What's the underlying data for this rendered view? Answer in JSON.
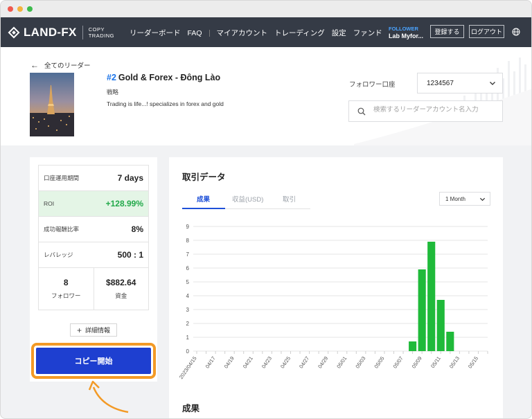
{
  "nav": {
    "logo_text": "LAND-FX",
    "logo_sub_line1": "COPY",
    "logo_sub_line2": "TRADING",
    "links": [
      "リーダーボード",
      "FAQ",
      "マイアカウント",
      "トレーディング",
      "設定",
      "ファンド"
    ],
    "follower_label": "FOLLOWER",
    "follower_name": "Lab Myfor...",
    "register_label": "登録する",
    "logout_label": "ログアウト"
  },
  "header": {
    "back_label": "全てのリーダー",
    "rank": "#2",
    "leader_name": "Gold & Forex - Đông Lào",
    "strategy_label": "戦略",
    "strategy_text": "Trading is life...! specializes in forex and gold",
    "follower_account_label": "フォロワー口座",
    "follower_account_value": "1234567",
    "search_placeholder": "検索するリーダーアカウント名入力"
  },
  "stats": {
    "period_label": "口座運用期間",
    "period_value": "7 days",
    "roi_label": "ROI",
    "roi_value": "+128.99%",
    "success_label": "成功報酬比率",
    "success_value": "8%",
    "leverage_label": "レバレッジ",
    "leverage_value": "500 : 1",
    "followers_value": "8",
    "followers_label": "フォロワー",
    "funds_value": "$882.64",
    "funds_label": "資金",
    "details_label": "詳細情報",
    "copy_label": "コピー開始"
  },
  "trading": {
    "title": "取引データ",
    "tabs": [
      "成果",
      "収益(USD)",
      "取引"
    ],
    "period_value": "1 Month",
    "bottom_title": "成果"
  },
  "colors": {
    "accent_blue": "#1e3fd0",
    "bar_green": "#1fba3a",
    "roi_green": "#22a94a",
    "highlight_orange": "#f39a26",
    "navbar": "#353b46"
  },
  "chart_data": {
    "type": "bar",
    "categories": [
      "2023/04/15",
      "04/16",
      "04/17",
      "04/18",
      "04/19",
      "04/20",
      "04/21",
      "04/22",
      "04/23",
      "04/24",
      "04/25",
      "04/26",
      "04/27",
      "04/28",
      "04/29",
      "04/30",
      "05/01",
      "05/02",
      "05/03",
      "05/04",
      "05/05",
      "05/06",
      "05/07",
      "05/08",
      "05/09",
      "05/10",
      "05/11",
      "05/12",
      "05/13",
      "05/14",
      "05/15",
      "05/16"
    ],
    "tick_labels": [
      "2023/04/15",
      "04/17",
      "04/19",
      "04/21",
      "04/23",
      "04/25",
      "04/27",
      "04/29",
      "05/01",
      "05/03",
      "05/05",
      "05/07",
      "05/09",
      "05/11",
      "05/13",
      "05/15"
    ],
    "values": [
      0,
      0,
      0,
      0,
      0,
      0,
      0,
      0,
      0,
      0,
      0,
      0,
      0,
      0,
      0,
      0,
      0,
      0,
      0,
      0,
      0,
      0,
      0,
      0.7,
      5.9,
      7.9,
      3.7,
      1.4,
      0,
      0,
      0,
      0
    ],
    "ylim": [
      0,
      9
    ],
    "yticks": [
      0,
      1,
      2,
      3,
      4,
      5,
      6,
      7,
      8,
      9
    ],
    "grid": true,
    "title": "",
    "xlabel": "",
    "ylabel": ""
  }
}
